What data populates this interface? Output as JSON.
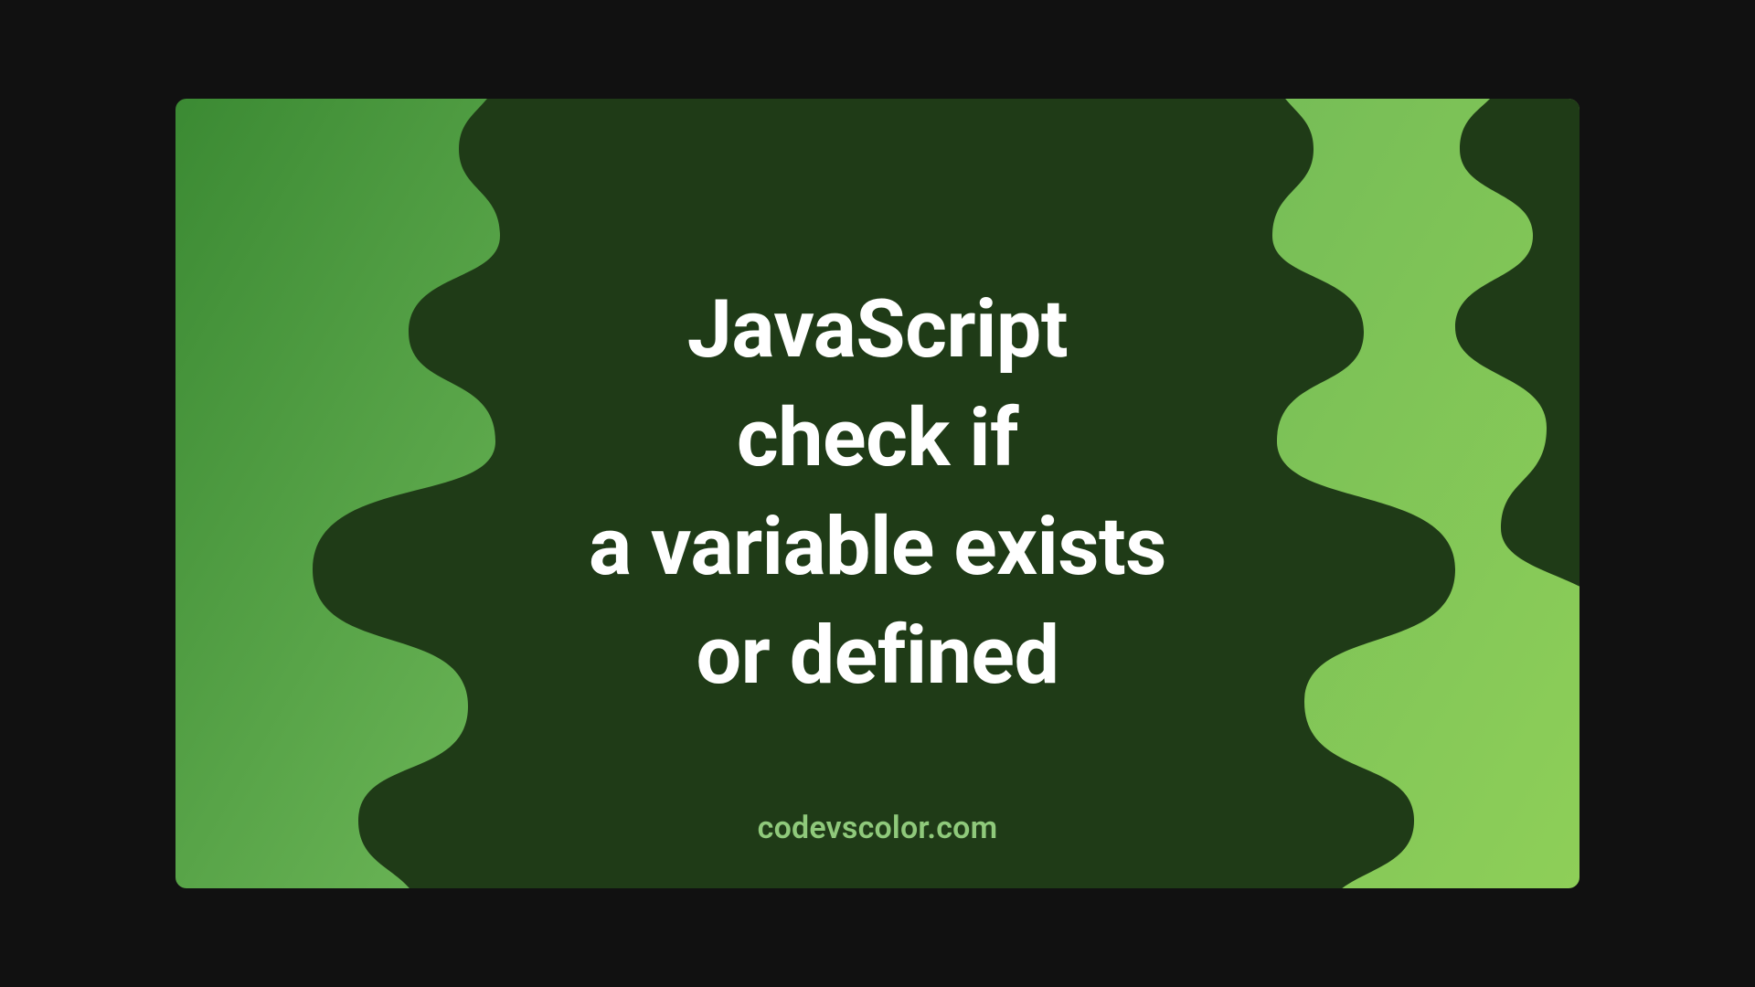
{
  "headline": {
    "line1": "JavaScript",
    "line2": "check if",
    "line3": "a variable exists",
    "line4": "or defined"
  },
  "attribution": "codevscolor.com",
  "colors": {
    "blob": "#1f3b17",
    "gradient_start": "#3b8a33",
    "gradient_end": "#8ecf58",
    "text": "#ffffff",
    "attribution": "#8fc97b"
  }
}
